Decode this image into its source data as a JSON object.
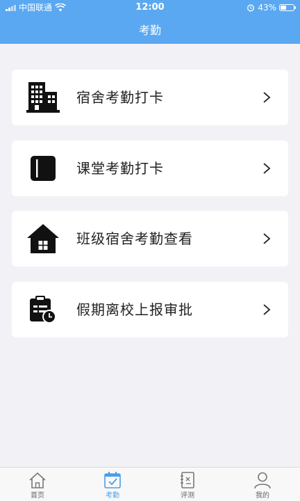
{
  "status_bar": {
    "carrier": "中国联通",
    "time": "12:00",
    "battery": "43%",
    "battery_level": 0.43
  },
  "header": {
    "title": "考勤"
  },
  "menu": [
    {
      "label": "宿舍考勤打卡",
      "icon": "building-icon"
    },
    {
      "label": "课堂考勤打卡",
      "icon": "book-icon"
    },
    {
      "label": "班级宿舍考勤查看",
      "icon": "house-icon"
    },
    {
      "label": "假期离校上报审批",
      "icon": "clipboard-clock-icon"
    }
  ],
  "tab_bar": {
    "active": "考勤",
    "tabs": [
      {
        "label": "首页",
        "icon": "home-icon"
      },
      {
        "label": "考勤",
        "icon": "calendar-check-icon"
      },
      {
        "label": "评测",
        "icon": "notebook-icon"
      },
      {
        "label": "我的",
        "icon": "person-icon"
      }
    ]
  },
  "colors": {
    "header": "#5aa8f1",
    "background": "#f2f2f6",
    "tab_active": "#4a9fe8"
  }
}
